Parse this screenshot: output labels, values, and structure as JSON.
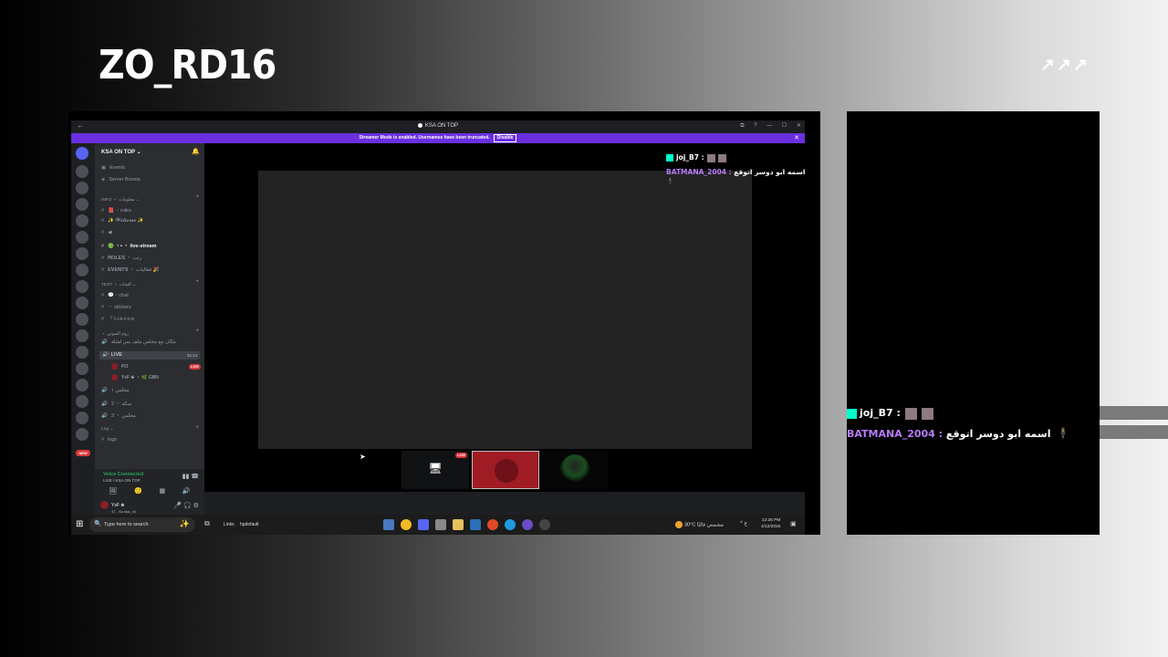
{
  "overlay": {
    "streamer_name": "ZO_RD16",
    "brand_arrows": "↗↗↗"
  },
  "window": {
    "back": "←",
    "title": "KSA ON TOP",
    "controls": [
      "⧉",
      "?",
      "—",
      "☐",
      "✕"
    ]
  },
  "banner": {
    "text": "Streamer Mode is enabled. Usernames have been truncated.",
    "button": "Disable",
    "close": "✕"
  },
  "server": {
    "name": "KSA ON TOP ⌄",
    "bell": "🔔",
    "top_items": [
      "Events",
      "Server Boosts"
    ],
    "categories": [
      {
        "label": "INFO ・ معلومات ⌄"
      },
      {
        "label": "TEXT ・ الشات ⌄"
      },
      {
        "label": "・ روم الصوتي"
      },
      {
        "label": "Log ⌄"
      }
    ],
    "channels": [
      "📕 ・rules",
      "✨ 𝓦𝓮𝓵𝓬𝓸𝓶𝓮 ✨",
      "◀",
      "🟢 ・▪ ・ live-stream",
      "𝐑𝐎𝐋𝐄𝐒 ・ رتب",
      "𝐄𝐕𝐄𝐍𝐓𝐒 ・ فعاليات 🎉",
      "💬・chat",
      "・ stickers",
      "『 t-i-k-t-o-k",
      "مكان مع مجلس ملف بس لشلة",
      "logs"
    ],
    "live_channel": {
      "name": "LIVE",
      "time": "34:14"
    },
    "voice_users": [
      {
        "name": "PO"
      },
      {
        "name": "YsF ❀ ・ 🌿 GBN"
      }
    ],
    "voice_channels": [
      "مجلس ١",
      "سكة ・ 2",
      "مجلس ・ 3"
    ],
    "live_badge": "LIVE",
    "new_badge": "NEW"
  },
  "voice_panel": {
    "status": "Voice Connected",
    "sub": "LIVE   / KSA ON TOP",
    "icons": [
      "▮▮",
      "☎"
    ],
    "row_icons": [
      "🖼",
      "🙂",
      "▦",
      "🔊"
    ]
  },
  "user": {
    "name": "YsF ❀",
    "status": "47 - So ska_44",
    "controls": [
      "🎤",
      "🎧",
      "⚙"
    ]
  },
  "stage": {
    "tile_icon": "🖥",
    "tile_live": "LIVE"
  },
  "chat": {
    "user1": "joj_B7 :",
    "user2": "BATMANA_2004 :",
    "message": "اسمه ابو دوسر اتوقع",
    "figure": "🕴"
  },
  "taskbar": {
    "start": "⊞",
    "search_placeholder": "Type here to search",
    "search_icon": "🔍",
    "spark": "✨",
    "task_view": "⧉",
    "links": "Links",
    "hp_default": "hpdefault",
    "weather": "30°C  مشمس غالبًا",
    "tray": "^  ع",
    "time": "12:25 PM",
    "date": "4/12/2025",
    "notif": "▣"
  },
  "colors": {
    "accent_purple": "#6b2fe0",
    "live_red": "#da373c",
    "chat_name": "#b67cf6",
    "voice_green": "#23a55a"
  }
}
